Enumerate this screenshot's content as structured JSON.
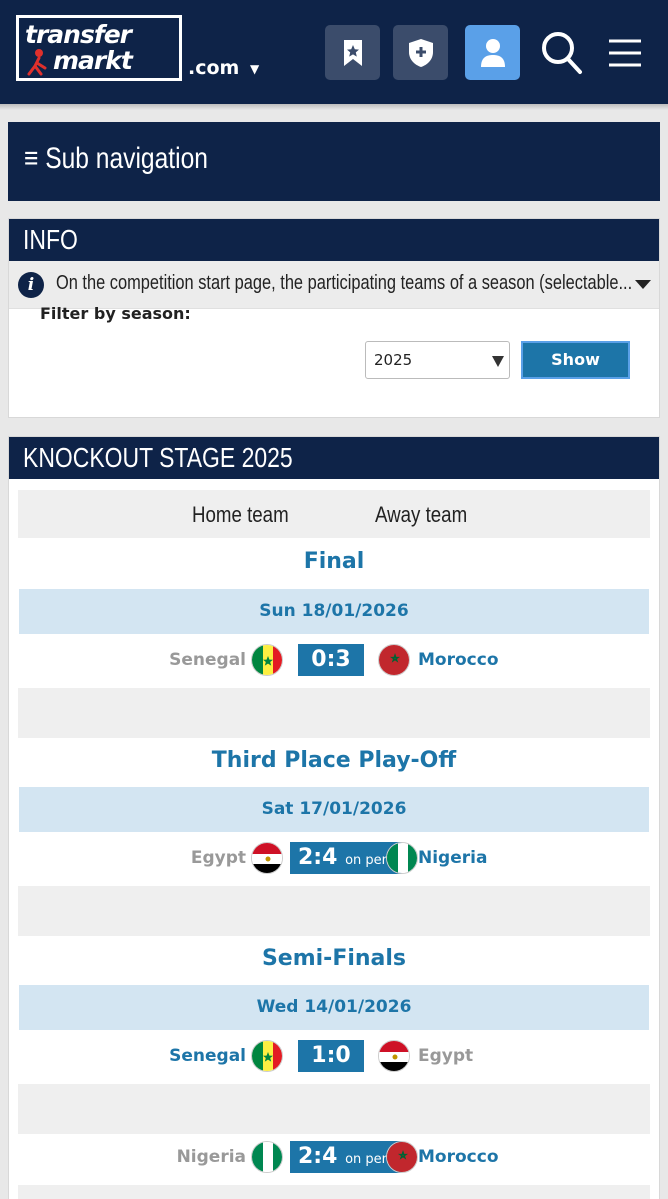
{
  "header": {
    "logo_line1": "transfer",
    "logo_line2": "markt",
    "domain_suffix": ".com",
    "buttons": [
      {
        "icon": "bookmark-star-icon"
      },
      {
        "icon": "shield-plus-icon"
      },
      {
        "icon": "user-icon",
        "active": true
      },
      {
        "icon": "search-icon"
      },
      {
        "icon": "hamburger-menu-icon"
      }
    ]
  },
  "subnav": {
    "label": "≡ Sub navigation"
  },
  "info": {
    "title": "INFO",
    "text": "On the competition start page, the participating teams of a season (selectable...",
    "filter_label": "Filter by season:",
    "season_value": "2025",
    "show_label": "Show"
  },
  "knockout": {
    "title": "KNOCKOUT STAGE 2025",
    "col_home": "Home team",
    "col_away": "Away team",
    "rounds": [
      {
        "name": "Final",
        "date": "Sun 18/01/2026",
        "matches": [
          {
            "home": "Senegal",
            "away": "Morocco",
            "score": "0:3",
            "note": "",
            "winner": "away"
          }
        ]
      },
      {
        "name": "Third Place Play-Off",
        "date": "Sat 17/01/2026",
        "matches": [
          {
            "home": "Egypt",
            "away": "Nigeria",
            "score": "2:4",
            "note": "on pen",
            "winner": "away"
          }
        ]
      },
      {
        "name": "Semi-Finals",
        "date": "Wed 14/01/2026",
        "matches": [
          {
            "home": "Senegal",
            "away": "Egypt",
            "score": "1:0",
            "note": "",
            "winner": "home"
          },
          {
            "home": "Nigeria",
            "away": "Morocco",
            "score": "2:4",
            "note": "on pen",
            "winner": "away"
          }
        ]
      }
    ]
  },
  "colors": {
    "navy": "#0e2348",
    "accent_blue": "#1d75a8",
    "date_bar": "#d3e5f2",
    "loser_grey": "#999999"
  }
}
